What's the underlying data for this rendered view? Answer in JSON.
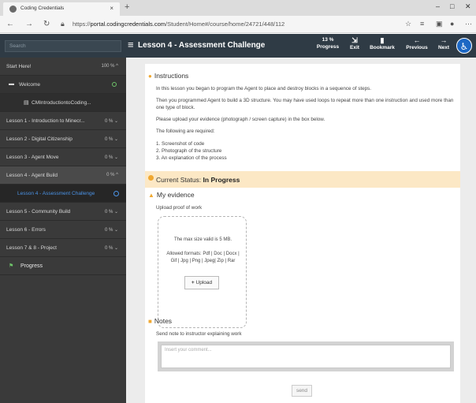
{
  "browser": {
    "tab_title": "Coding Credentials",
    "tab_close": "×",
    "new_tab": "+",
    "win_min": "–",
    "win_max": "□",
    "win_close": "✕",
    "url_prefix": "https://",
    "url_host": "portal.codingcredentials.com",
    "url_path": "/Student/Home#/course/home/24721/448/112"
  },
  "appbar": {
    "search_placeholder": "Search",
    "lesson_title": "Lesson 4 - Assessment Challenge",
    "progress_value": "13 %",
    "progress_label": "Progress",
    "exit_label": "Exit",
    "bookmark_label": "Bookmark",
    "previous_label": "Previous",
    "next_label": "Next"
  },
  "sidebar": {
    "start": {
      "label": "Start Here!",
      "meta": "100 % ^"
    },
    "welcome": {
      "label": "Welcome"
    },
    "welcome_sub": {
      "label": "CMIntroductiontoCoding..."
    },
    "lessons": [
      {
        "label": "Lesson 1 - Introduction to Minecr...",
        "meta": "0 % ⌄"
      },
      {
        "label": "Lesson 2 - Digital Citizenship",
        "meta": "0 % ⌄"
      },
      {
        "label": "Lesson 3 - Agent Move",
        "meta": "0 % ⌄"
      },
      {
        "label": "Lesson 4 - Agent Build",
        "meta": "0 % ^"
      },
      {
        "label": "Lesson 4 - Assessment Challenge",
        "meta": ""
      },
      {
        "label": "Lesson 5 - Community Build",
        "meta": "0 % ⌄"
      },
      {
        "label": "Lesson 6 - Errors",
        "meta": "0 % ⌄"
      },
      {
        "label": "Lesson 7 & 8 - Project",
        "meta": "0 % ⌄"
      }
    ],
    "progress": {
      "label": "Progress"
    }
  },
  "main": {
    "instructions_heading": "Instructions",
    "para1": "In this lesson you began to program the Agent to place and destroy blocks in a sequence of steps.",
    "para2": "Then you programmed Agent to build a 3D structure. You may have used loops to repeat more than one instruction and used more than one type of block.",
    "para3": "Please upload your evidence (photograph / screen capture) in the box below.",
    "para4": "The following are required:",
    "req1": "1. Screenshot of code",
    "req2": "2. Photograph of the structure",
    "req3": "3. An explanation of the process",
    "status_prefix": "Current Status:",
    "status_value": "In Progress",
    "evidence_heading": "My evidence",
    "upload_label": "Upload proof of work",
    "max_size": "The max size valid is 5 MB.",
    "formats_1": "Allowed formats: Pdf | Doc | Docx |",
    "formats_2": "Gif | Jpg | Png | Jpeg| Zip | Rar",
    "upload_button": "Upload",
    "notes_heading": "Notes",
    "notes_label": "Send note to instructor explaining work",
    "notes_placeholder": "Insert your comment...",
    "send_button": "send"
  },
  "colors": {
    "appbar_bg": "#2f3b45",
    "sidebar_bg": "#3a3a3a",
    "status_bg": "#fce8c5",
    "accent_blue": "#4b93e6",
    "accent_orange": "#f0a830"
  }
}
